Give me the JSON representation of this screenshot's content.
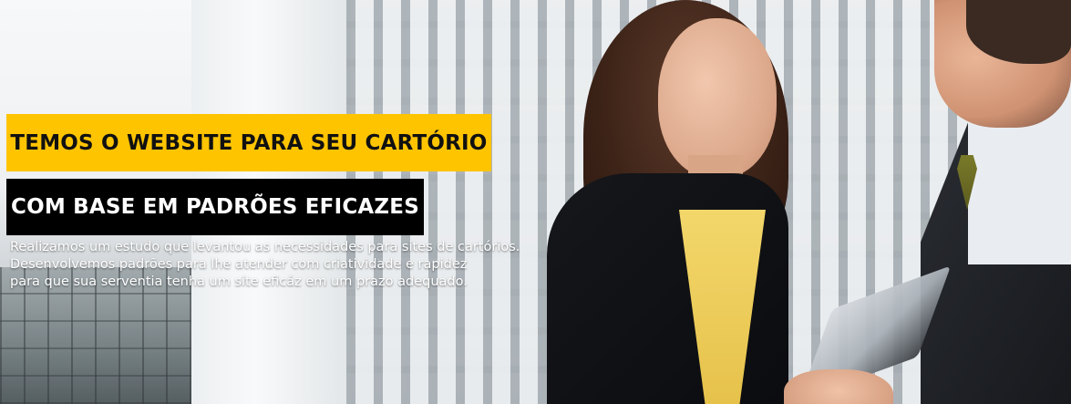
{
  "hero": {
    "headline_primary": "TEMOS O WEBSITE PARA SEU CARTÓRIO",
    "headline_secondary": "COM BASE EM PADRÕES EFICAZES",
    "description_lines": [
      "Realizamos um estudo que levantou as necessidades para sites de cartórios.",
      "Desenvolvemos padrões para lhe atender com criatividade e rapidez",
      "para que sua serventia tenha um site eficáz em um prazo adequado."
    ]
  },
  "colors": {
    "accent_yellow": "#ffc400",
    "label_black": "#000000",
    "text_white": "#ffffff"
  }
}
